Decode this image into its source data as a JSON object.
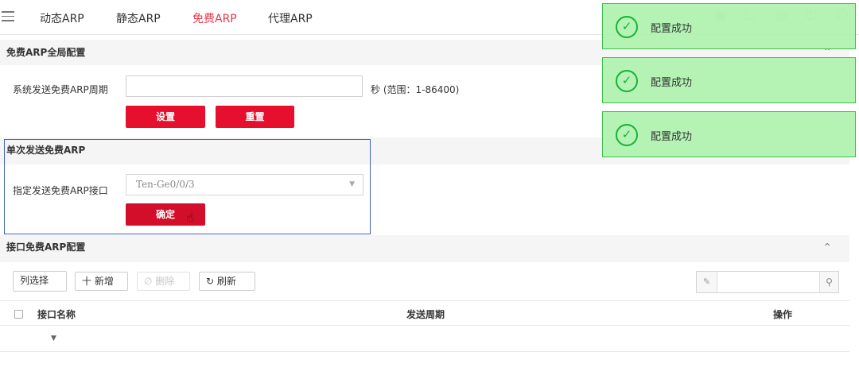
{
  "tabs": [
    {
      "label": "动态ARP",
      "active": false
    },
    {
      "label": "静态ARP",
      "active": false
    },
    {
      "label": "免费ARP",
      "active": true
    },
    {
      "label": "代理ARP",
      "active": false
    }
  ],
  "top_icons": [
    "save-icon",
    "lock-icon",
    "console-icon",
    "power-icon",
    "user-icon"
  ],
  "global_config": {
    "title": "免费ARP全局配置",
    "period_label": "系统发送免费ARP周期",
    "period_value": "",
    "unit_hint": "秒 (范围：1-86400)",
    "set_button": "设置",
    "reset_button": "重置"
  },
  "single_send": {
    "title": "单次发送免费ARP",
    "interface_label": "指定发送免费ARP接口",
    "interface_value": "Ten-Ge0/0/3",
    "confirm_button": "确定"
  },
  "interface_config": {
    "title": "接口免费ARP配置",
    "toolbar": {
      "column_select": "列选择",
      "add": "十 新增",
      "delete": "删除",
      "refresh": "刷新"
    },
    "search_value": "",
    "columns": [
      "接口名称",
      "发送周期",
      "操作"
    ],
    "rows": []
  },
  "toasts": [
    {
      "message": "配置成功"
    },
    {
      "message": "配置成功"
    },
    {
      "message": "配置成功"
    }
  ],
  "colors": {
    "accent_red": "#e60f2d",
    "active_tab": "#e8364a",
    "toast_bg": "#aff2af",
    "success_green": "#16b236",
    "highlight_border": "#3f61b8"
  }
}
